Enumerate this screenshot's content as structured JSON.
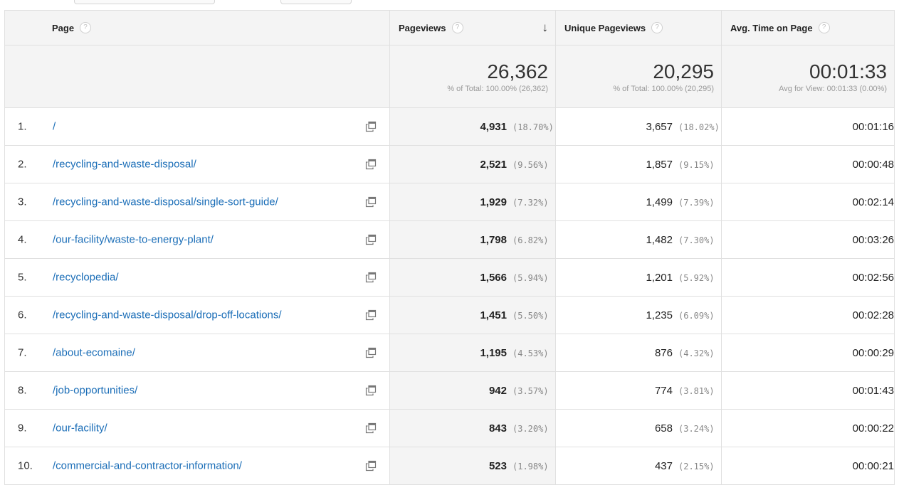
{
  "columns": {
    "page": "Page",
    "pageviews": "Pageviews",
    "unique_pageviews": "Unique Pageviews",
    "avg_time": "Avg. Time on Page",
    "help_glyph": "?",
    "sort_arrow": "↓"
  },
  "totals": {
    "pageviews": "26,362",
    "pageviews_sub": "% of Total: 100.00% (26,362)",
    "unique_pageviews": "20,295",
    "unique_pageviews_sub": "% of Total: 100.00% (20,295)",
    "avg_time": "00:01:33",
    "avg_time_sub": "Avg for View: 00:01:33 (0.00%)"
  },
  "rows": [
    {
      "num": "1.",
      "page": "/",
      "pv": "4,931",
      "pv_pct": "(18.70%)",
      "upv": "3,657",
      "upv_pct": "(18.02%)",
      "avg": "00:01:16"
    },
    {
      "num": "2.",
      "page": "/recycling-and-waste-disposal/",
      "pv": "2,521",
      "pv_pct": "(9.56%)",
      "upv": "1,857",
      "upv_pct": "(9.15%)",
      "avg": "00:00:48"
    },
    {
      "num": "3.",
      "page": "/recycling-and-waste-disposal/single-sort-guide/",
      "pv": "1,929",
      "pv_pct": "(7.32%)",
      "upv": "1,499",
      "upv_pct": "(7.39%)",
      "avg": "00:02:14"
    },
    {
      "num": "4.",
      "page": "/our-facility/waste-to-energy-plant/",
      "pv": "1,798",
      "pv_pct": "(6.82%)",
      "upv": "1,482",
      "upv_pct": "(7.30%)",
      "avg": "00:03:26"
    },
    {
      "num": "5.",
      "page": "/recyclopedia/",
      "pv": "1,566",
      "pv_pct": "(5.94%)",
      "upv": "1,201",
      "upv_pct": "(5.92%)",
      "avg": "00:02:56"
    },
    {
      "num": "6.",
      "page": "/recycling-and-waste-disposal/drop-off-locations/",
      "pv": "1,451",
      "pv_pct": "(5.50%)",
      "upv": "1,235",
      "upv_pct": "(6.09%)",
      "avg": "00:02:28"
    },
    {
      "num": "7.",
      "page": "/about-ecomaine/",
      "pv": "1,195",
      "pv_pct": "(4.53%)",
      "upv": "876",
      "upv_pct": "(4.32%)",
      "avg": "00:00:29"
    },
    {
      "num": "8.",
      "page": "/job-opportunities/",
      "pv": "942",
      "pv_pct": "(3.57%)",
      "upv": "774",
      "upv_pct": "(3.81%)",
      "avg": "00:01:43"
    },
    {
      "num": "9.",
      "page": "/our-facility/",
      "pv": "843",
      "pv_pct": "(3.20%)",
      "upv": "658",
      "upv_pct": "(3.24%)",
      "avg": "00:00:22"
    },
    {
      "num": "10.",
      "page": "/commercial-and-contractor-information/",
      "pv": "523",
      "pv_pct": "(1.98%)",
      "upv": "437",
      "upv_pct": "(2.15%)",
      "avg": "00:00:21"
    }
  ],
  "colors": {
    "link": "#1a6db7",
    "header_bg": "#f4f4f4",
    "border": "#e0e0e0"
  },
  "icons": {
    "row_action": "open-in-new-window-icon",
    "help": "help-icon",
    "sort": "sort-descending-icon"
  }
}
